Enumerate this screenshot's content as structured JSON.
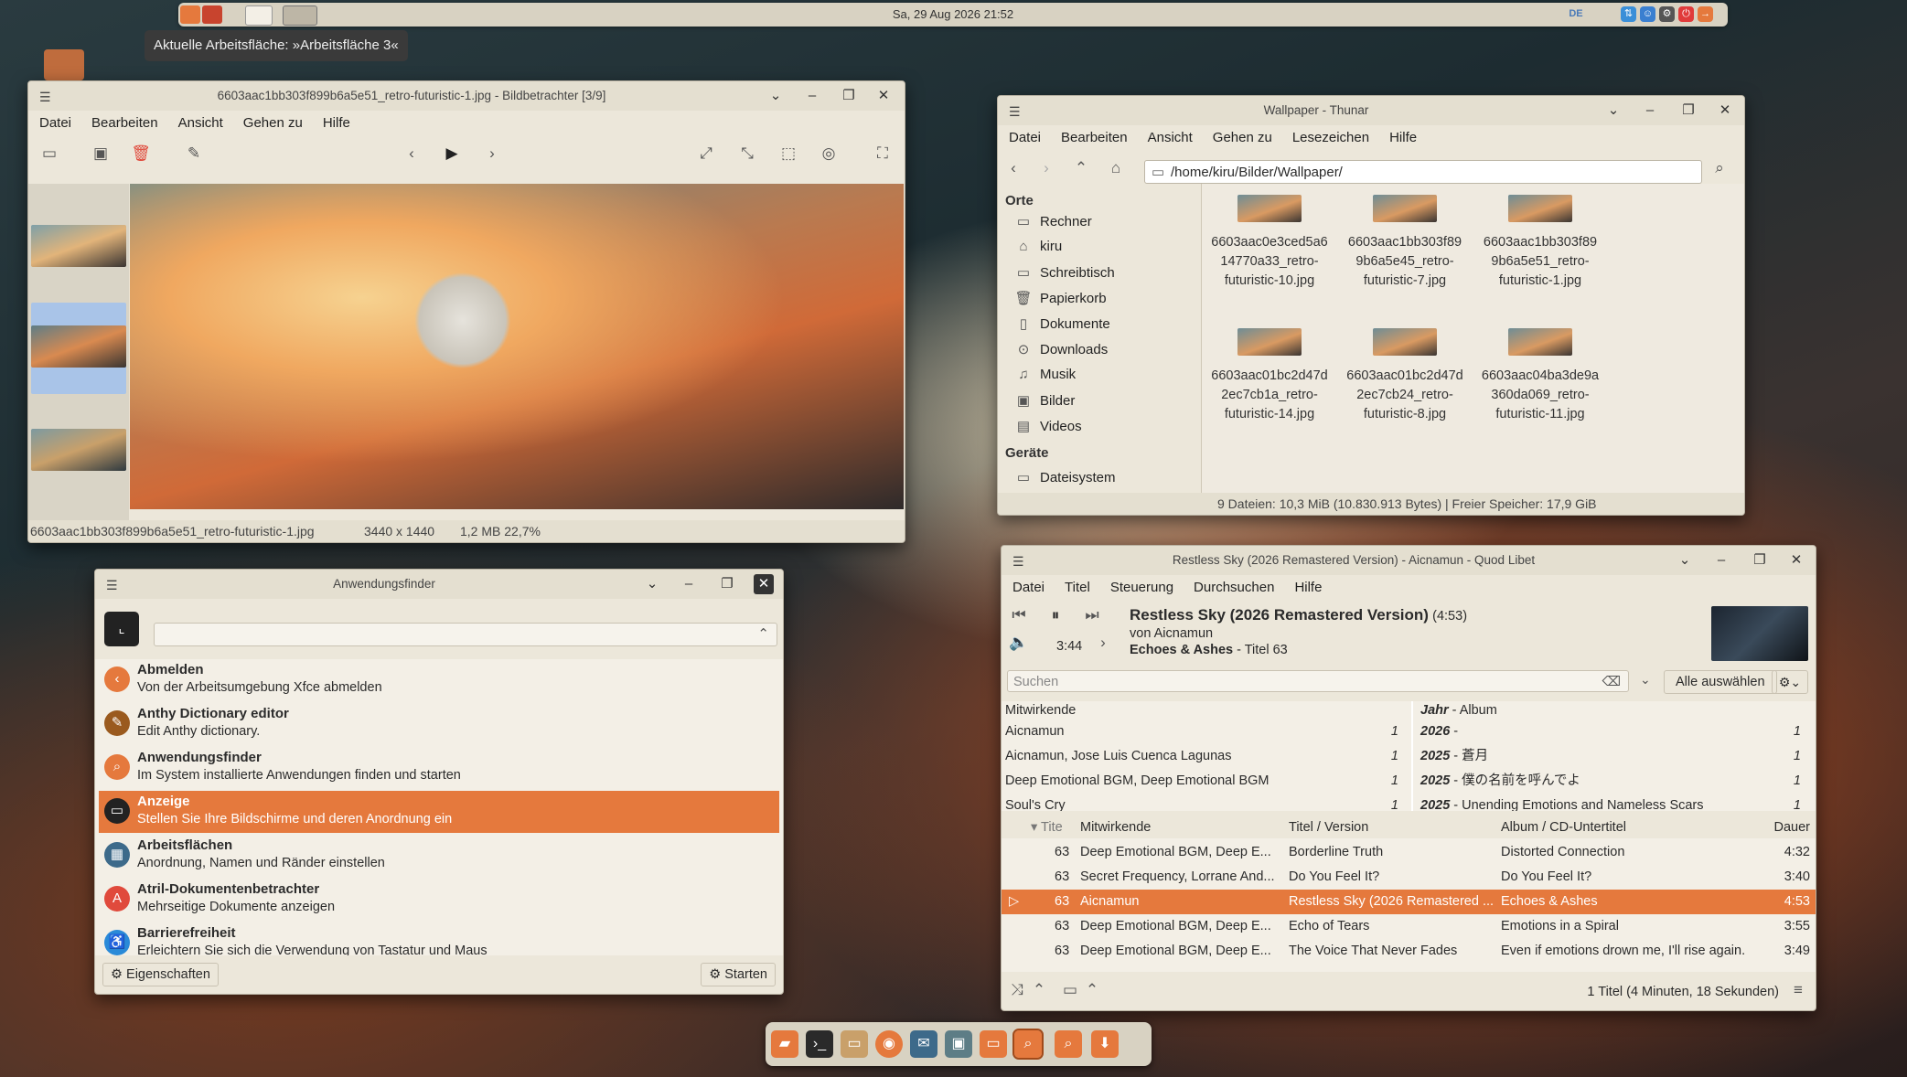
{
  "top_panel": {
    "clock": "Sa, 29 Aug 2026  21:52",
    "keyboard_layout": "DE",
    "workspace_tooltip": "Aktuelle Arbeitsfläche: »Arbeitsfläche 3«"
  },
  "viewer": {
    "title": "6603aac1bb303f899b6a5e51_retro-futuristic-1.jpg - Bildbetrachter [3/9]",
    "menu": [
      "Datei",
      "Bearbeiten",
      "Ansicht",
      "Gehen zu",
      "Hilfe"
    ],
    "status_filename": "6603aac1bb303f899b6a5e51_retro-futuristic-1.jpg",
    "status_size": "3440 x 1440",
    "status_info": "1,2 MB 22,7%"
  },
  "thunar": {
    "title": "Wallpaper - Thunar",
    "menu": [
      "Datei",
      "Bearbeiten",
      "Ansicht",
      "Gehen zu",
      "Lesezeichen",
      "Hilfe"
    ],
    "path": "/home/kiru/Bilder/Wallpaper/",
    "places_header": "Orte",
    "places": [
      "Rechner",
      "kiru",
      "Schreibtisch",
      "Papierkorb",
      "Dokumente",
      "Downloads",
      "Musik",
      "Bilder",
      "Videos"
    ],
    "devices_header": "Geräte",
    "devices": [
      "Dateisystem"
    ],
    "files": [
      [
        "6603aac0e3ced5a6",
        "14770a33_retro-",
        "futuristic-10.jpg"
      ],
      [
        "6603aac1bb303f89",
        "9b6a5e45_retro-",
        "futuristic-7.jpg"
      ],
      [
        "6603aac1bb303f89",
        "9b6a5e51_retro-",
        "futuristic-1.jpg"
      ],
      [
        "6603aac01bc2d47d",
        "2ec7cb1a_retro-",
        "futuristic-14.jpg"
      ],
      [
        "6603aac01bc2d47d",
        "2ec7cb24_retro-",
        "futuristic-8.jpg"
      ],
      [
        "6603aac04ba3de9a",
        "360da069_retro-",
        "futuristic-11.jpg"
      ]
    ],
    "status": "9 Dateien: 10,3 MiB (10.830.913 Bytes)  |  Freier Speicher: 17,9 GiB"
  },
  "finder": {
    "title": "Anwendungsfinder",
    "apps": [
      {
        "name": "Abmelden",
        "desc": "Von der Arbeitsumgebung Xfce abmelden",
        "color": "#e5793d",
        "icon": "logout-icon",
        "glyph": "‹"
      },
      {
        "name": "Anthy Dictionary editor",
        "desc": "Edit Anthy dictionary.",
        "color": "#9a5a1e",
        "icon": "dictionary-icon",
        "glyph": "✎"
      },
      {
        "name": "Anwendungsfinder",
        "desc": "Im System installierte Anwendungen finden und starten",
        "color": "#e5793d",
        "icon": "search-icon",
        "glyph": "⌕"
      },
      {
        "name": "Anzeige",
        "desc": "Stellen Sie Ihre Bildschirme und deren Anordnung ein",
        "color": "#222222",
        "icon": "display-icon",
        "glyph": "▭"
      },
      {
        "name": "Arbeitsflächen",
        "desc": "Anordnung, Namen und Ränder einstellen",
        "color": "#3d6a8a",
        "icon": "workspaces-icon",
        "glyph": "▦"
      },
      {
        "name": "Atril-Dokumentenbetrachter",
        "desc": "Mehrseitige Dokumente anzeigen",
        "color": "#e04a3c",
        "icon": "pdf-icon",
        "glyph": "A"
      },
      {
        "name": "Barrierefreiheit",
        "desc": "Erleichtern Sie sich die Verwendung von Tastatur und Maus",
        "color": "#2a8ad8",
        "icon": "accessibility-icon",
        "glyph": "♿"
      }
    ],
    "properties_label": "Eigenschaften",
    "launch_label": "Starten"
  },
  "quodlibet": {
    "title": "Restless Sky (2026 Remastered Version) - Aicnamun - Quod Libet",
    "menu": [
      "Datei",
      "Titel",
      "Steuerung",
      "Durchsuchen",
      "Hilfe"
    ],
    "track_title": "Restless Sky (2026 Remastered Version)",
    "track_length": "(4:53)",
    "track_artist": "von Aicnamun",
    "track_album": "Echoes & Ashes",
    "track_num": " - Titel 63",
    "elapsed": "3:44",
    "search_placeholder": "Suchen",
    "select_all": "Alle auswählen",
    "artists_header": "Mitwirkende",
    "artists": [
      {
        "name": "Aicnamun",
        "n": "1"
      },
      {
        "name": "Aicnamun, Jose Luis Cuenca Lagunas",
        "n": "1"
      },
      {
        "name": "Deep Emotional BGM, Deep Emotional BGM",
        "n": "1"
      },
      {
        "name": "Soul's Cry",
        "n": "1"
      }
    ],
    "albums_header_year": "Jahr",
    "albums_header": " - Album",
    "albums": [
      {
        "year": "2026",
        "album": " - ",
        "n": "1"
      },
      {
        "year": "2025",
        "album": " - 蒼月",
        "n": "1"
      },
      {
        "year": "2025",
        "album": " - 僕の名前を呼んでよ",
        "n": "1"
      },
      {
        "year": "2025",
        "album": " - Unending Emotions and Nameless Scars",
        "n": "1"
      }
    ],
    "columns": [
      "Tite",
      "Mitwirkende",
      "Titel / Version",
      "Album / CD-Untertitel",
      "Dauer"
    ],
    "tracks": [
      {
        "no": "63",
        "artist": "Deep Emotional BGM, Deep E...",
        "title": "Borderline Truth",
        "album": "Distorted Connection",
        "dur": "4:32"
      },
      {
        "no": "63",
        "artist": "Secret Frequency, Lorrane And...",
        "title": "Do You Feel It?",
        "album": "Do You Feel It?",
        "dur": "3:40"
      },
      {
        "no": "63",
        "artist": "Aicnamun",
        "title": "Restless Sky (2026 Remastered ...",
        "album": "Echoes & Ashes",
        "dur": "4:53"
      },
      {
        "no": "63",
        "artist": "Deep Emotional BGM, Deep E...",
        "title": "Echo of Tears",
        "album": "Emotions in a Spiral",
        "dur": "3:55"
      },
      {
        "no": "63",
        "artist": "Deep Emotional BGM, Deep E...",
        "title": "The Voice That Never Fades",
        "album": "Even if emotions drown me, I'll rise again.",
        "dur": "3:49"
      }
    ],
    "status": "1 Titel (4 Minuten, 18 Sekunden)"
  },
  "colors": {
    "accent": "#e5793d",
    "panel": "#d8d2c2",
    "window": "#ece7da"
  }
}
